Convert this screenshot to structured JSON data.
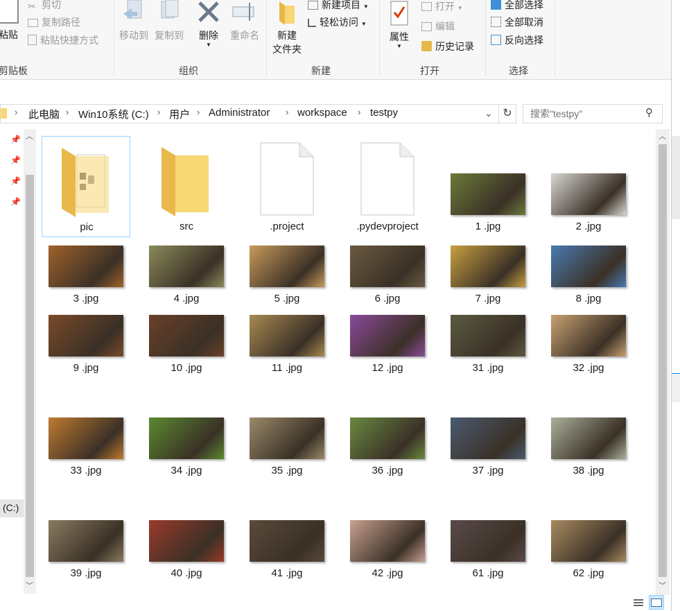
{
  "ribbon": {
    "clipboard": {
      "paste_label": "粘贴",
      "cut_label": "剪切",
      "copy_path_label": "复制路径",
      "paste_shortcut_label": "粘贴快捷方式",
      "group_label": "剪贴板"
    },
    "organize": {
      "move_to_label": "移动到",
      "copy_to_label": "复制到",
      "delete_label": "删除",
      "rename_label": "重命名",
      "group_label": "组织"
    },
    "new": {
      "new_folder_label_1": "新建",
      "new_folder_label_2": "文件夹",
      "new_item_label": "新建项目",
      "easy_access_label": "轻松访问",
      "group_label": "新建"
    },
    "open": {
      "properties_label": "属性",
      "open_label": "打开",
      "edit_label": "编辑",
      "history_label": "历史记录",
      "group_label": "打开"
    },
    "select": {
      "select_all_label": "全部选择",
      "select_none_label": "全部取消",
      "invert_label": "反向选择",
      "group_label": "选择"
    }
  },
  "address": {
    "crumbs": [
      "此电脑",
      "Win10系统 (C:)",
      "用户",
      "Administrator",
      "workspace",
      "testpy"
    ]
  },
  "search": {
    "placeholder": "搜索\"testpy\""
  },
  "nav": {
    "drive_label": "(C:)"
  },
  "items": [
    {
      "name": "pic",
      "kind": "folder-preview"
    },
    {
      "name": "src",
      "kind": "folder"
    },
    {
      "name": ".project",
      "kind": "file"
    },
    {
      "name": ".pydevproject",
      "kind": "file"
    },
    {
      "name": "1 .jpg",
      "kind": "image",
      "color": "#6b7a3a"
    },
    {
      "name": "2 .jpg",
      "kind": "image",
      "color": "#d8d6d2"
    },
    {
      "name": "3 .jpg",
      "kind": "image",
      "color": "#a0622a"
    },
    {
      "name": "4 .jpg",
      "kind": "image",
      "color": "#8a8a5a"
    },
    {
      "name": "5 .jpg",
      "kind": "image",
      "color": "#c89a5a"
    },
    {
      "name": "6 .jpg",
      "kind": "image",
      "color": "#6a5a40"
    },
    {
      "name": "7 .jpg",
      "kind": "image",
      "color": "#c8a040"
    },
    {
      "name": "8 .jpg",
      "kind": "image",
      "color": "#4a7ab0"
    },
    {
      "name": "9 .jpg",
      "kind": "image",
      "color": "#7a4a28"
    },
    {
      "name": "10 .jpg",
      "kind": "image",
      "color": "#6a4028"
    },
    {
      "name": "11 .jpg",
      "kind": "image",
      "color": "#a88a50"
    },
    {
      "name": "12 .jpg",
      "kind": "image",
      "color": "#8a4a9a"
    },
    {
      "name": "31 .jpg",
      "kind": "image",
      "color": "#5a5a40"
    },
    {
      "name": "32 .jpg",
      "kind": "image",
      "color": "#c8a070"
    },
    {
      "name": "33 .jpg",
      "kind": "image",
      "color": "#c07a30"
    },
    {
      "name": "34 .jpg",
      "kind": "image",
      "color": "#5a8a30"
    },
    {
      "name": "35 .jpg",
      "kind": "image",
      "color": "#9a8a6a"
    },
    {
      "name": "36 .jpg",
      "kind": "image",
      "color": "#6a8a40"
    },
    {
      "name": "37 .jpg",
      "kind": "image",
      "color": "#4a5a70"
    },
    {
      "name": "38 .jpg",
      "kind": "image",
      "color": "#aab09a"
    },
    {
      "name": "39 .jpg",
      "kind": "image",
      "color": "#8a7a60"
    },
    {
      "name": "40 .jpg",
      "kind": "image",
      "color": "#9a3a2a"
    },
    {
      "name": "41 .jpg",
      "kind": "image",
      "color": "#5a4a3a"
    },
    {
      "name": "42 .jpg",
      "kind": "image",
      "color": "#c8a090"
    },
    {
      "name": "61 .jpg",
      "kind": "image",
      "color": "#5a4a4a"
    },
    {
      "name": "62 .jpg",
      "kind": "image",
      "color": "#a88a60"
    }
  ],
  "colors": {
    "accent": "#0078d7",
    "folder": "#f8d775",
    "ribbon_bg": "#f7f7f7"
  }
}
